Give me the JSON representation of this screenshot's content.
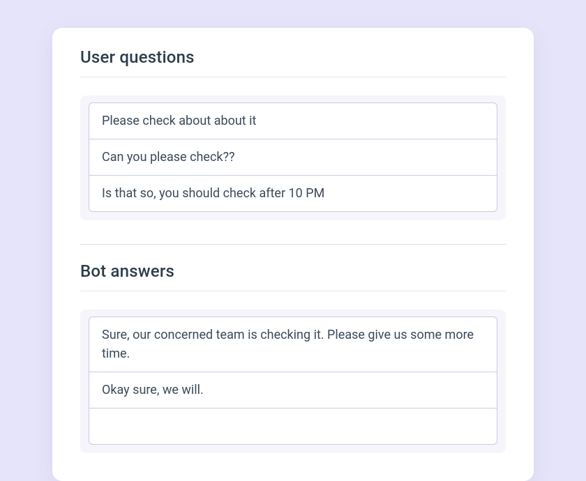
{
  "sections": {
    "user_questions": {
      "title": "User questions",
      "items": [
        "Please check about about it",
        "Can you please check??",
        "Is that so, you should check after 10 PM"
      ]
    },
    "bot_answers": {
      "title": "Bot answers",
      "items": [
        "Sure, our concerned team is checking it. Please give us some more time.",
        "Okay sure, we will."
      ]
    }
  }
}
